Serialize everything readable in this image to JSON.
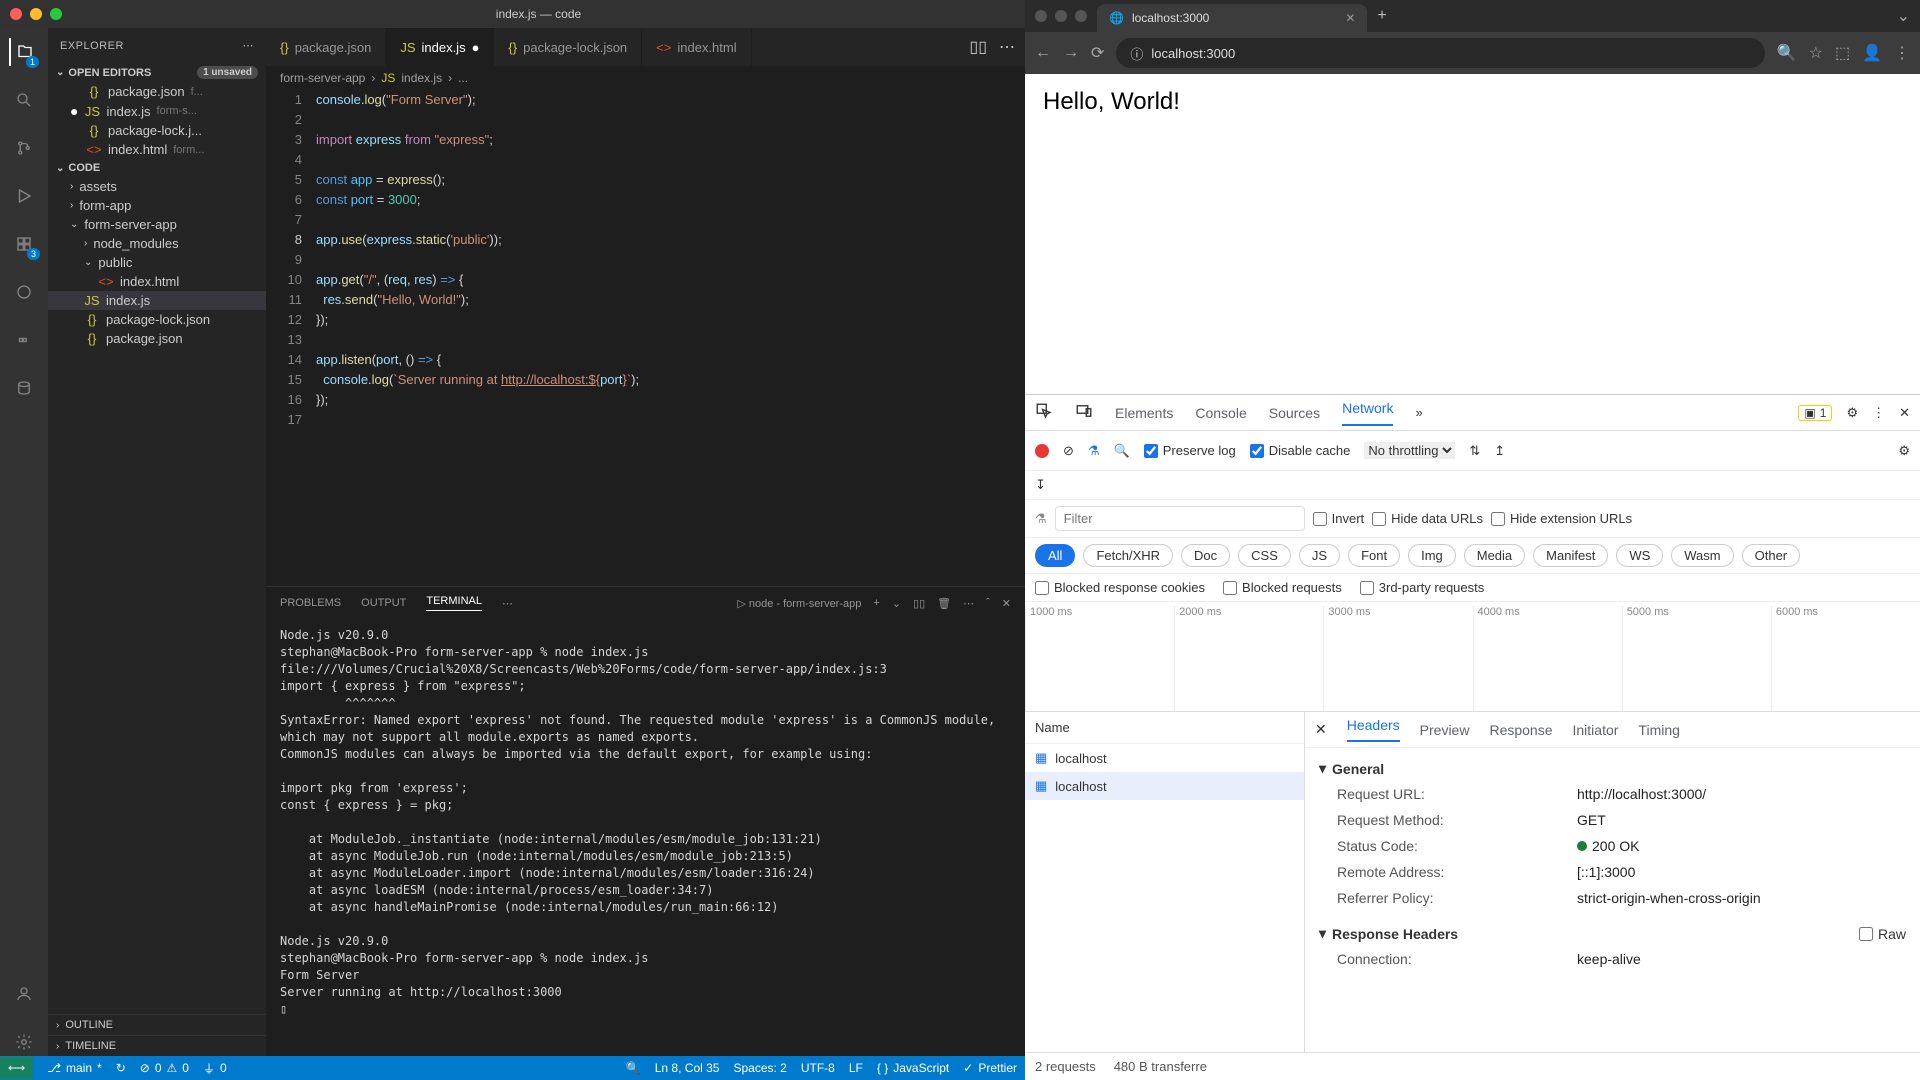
{
  "vscode": {
    "title": "index.js — code",
    "explorer_label": "EXPLORER",
    "open_editors_label": "OPEN EDITORS",
    "unsaved_badge": "1 unsaved",
    "open_editors": [
      {
        "name": "package.json",
        "meta": "f...",
        "icon": "json"
      },
      {
        "name": "index.js",
        "meta": "form-s...",
        "icon": "js",
        "modified": true
      },
      {
        "name": "package-lock.j...",
        "meta": "",
        "icon": "json"
      },
      {
        "name": "index.html",
        "meta": "form...",
        "icon": "html"
      }
    ],
    "workspace_label": "CODE",
    "tree": [
      {
        "name": "assets",
        "type": "folder",
        "chev": "›",
        "indent": 1
      },
      {
        "name": "form-app",
        "type": "folder",
        "chev": "›",
        "indent": 1
      },
      {
        "name": "form-server-app",
        "type": "folder",
        "chev": "⌄",
        "indent": 1
      },
      {
        "name": "node_modules",
        "type": "folder",
        "chev": "›",
        "indent": 2
      },
      {
        "name": "public",
        "type": "folder",
        "chev": "⌄",
        "indent": 2
      },
      {
        "name": "index.html",
        "type": "file",
        "icon": "html",
        "indent": 3
      },
      {
        "name": "index.js",
        "type": "file",
        "icon": "js",
        "indent": 2,
        "selected": true
      },
      {
        "name": "package-lock.json",
        "type": "file",
        "icon": "json",
        "indent": 2
      },
      {
        "name": "package.json",
        "type": "file",
        "icon": "json",
        "indent": 2
      }
    ],
    "outline_label": "OUTLINE",
    "timeline_label": "TIMELINE",
    "tabs": [
      {
        "name": "package.json",
        "icon": "json"
      },
      {
        "name": "index.js",
        "icon": "js",
        "active": true,
        "modified": true
      },
      {
        "name": "package-lock.json",
        "icon": "json"
      },
      {
        "name": "index.html",
        "icon": "html"
      }
    ],
    "breadcrumb": [
      "form-server-app",
      "index.js",
      "..."
    ],
    "panel_tabs": [
      "PROBLEMS",
      "OUTPUT",
      "TERMINAL"
    ],
    "panel_active": "TERMINAL",
    "terminal_task": "node - form-server-app",
    "terminal_text": "Node.js v20.9.0\nstephan@MacBook-Pro form-server-app % node index.js\nfile:///Volumes/Crucial%20X8/Screencasts/Web%20Forms/code/form-server-app/index.js:3\nimport { express } from \"express\";\n         ^^^^^^^\nSyntaxError: Named export 'express' not found. The requested module 'express' is a CommonJS module, which may not support all module.exports as named exports.\nCommonJS modules can always be imported via the default export, for example using:\n\nimport pkg from 'express';\nconst { express } = pkg;\n\n    at ModuleJob._instantiate (node:internal/modules/esm/module_job:131:21)\n    at async ModuleJob.run (node:internal/modules/esm/module_job:213:5)\n    at async ModuleLoader.import (node:internal/modules/esm/loader:316:24)\n    at async loadESM (node:internal/process/esm_loader:34:7)\n    at async handleMainPromise (node:internal/modules/run_main:66:12)\n\nNode.js v20.9.0\nstephan@MacBook-Pro form-server-app % node index.js\nForm Server\nServer running at http://localhost:3000\n▯",
    "status": {
      "branch": "main",
      "sync": "↻",
      "errors": "0",
      "warnings": "0",
      "port": "0",
      "line_col": "Ln 8, Col 35",
      "spaces": "Spaces: 2",
      "encoding": "UTF-8",
      "eol": "LF",
      "lang": "JavaScript",
      "formatter": "Prettier"
    },
    "scm_badge": "3",
    "explorer_badge": "1"
  },
  "browser": {
    "tab_title": "localhost:3000",
    "url": "localhost:3000",
    "page_text": "Hello, World!",
    "devtools": {
      "tabs": [
        "Elements",
        "Console",
        "Sources",
        "Network"
      ],
      "active_tab": "Network",
      "issues": "1",
      "preserve_log": "Preserve log",
      "disable_cache": "Disable cache",
      "throttling": "No throttling",
      "filter_placeholder": "Filter",
      "checks": [
        "Invert",
        "Hide data URLs",
        "Hide extension URLs"
      ],
      "type_filters": [
        "All",
        "Fetch/XHR",
        "Doc",
        "CSS",
        "JS",
        "Font",
        "Img",
        "Media",
        "Manifest",
        "WS",
        "Wasm",
        "Other"
      ],
      "more_filters": [
        "Blocked response cookies",
        "Blocked requests",
        "3rd-party requests"
      ],
      "timeline_ticks": [
        "1000 ms",
        "2000 ms",
        "3000 ms",
        "4000 ms",
        "5000 ms",
        "6000 ms"
      ],
      "req_header": "Name",
      "requests": [
        "localhost",
        "localhost"
      ],
      "detail_tabs": [
        "Headers",
        "Preview",
        "Response",
        "Initiator",
        "Timing"
      ],
      "detail_active": "Headers",
      "general_label": "General",
      "response_headers_label": "Response Headers",
      "raw_label": "Raw",
      "kv": [
        {
          "k": "Request URL:",
          "v": "http://localhost:3000/"
        },
        {
          "k": "Request Method:",
          "v": "GET"
        },
        {
          "k": "Status Code:",
          "v": "200 OK",
          "status": true
        },
        {
          "k": "Remote Address:",
          "v": "[::1]:3000"
        },
        {
          "k": "Referrer Policy:",
          "v": "strict-origin-when-cross-origin"
        }
      ],
      "resp_kv": [
        {
          "k": "Connection:",
          "v": "keep-alive"
        }
      ],
      "status_text": [
        "2 requests",
        "480 B transferre"
      ]
    }
  }
}
